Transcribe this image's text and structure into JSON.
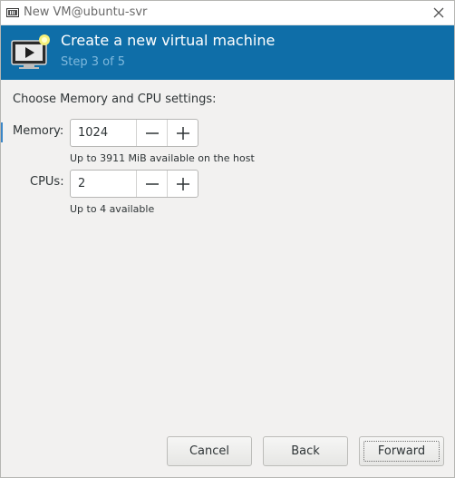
{
  "window": {
    "title": "New VM@ubuntu-svr"
  },
  "header": {
    "title": "Create a new virtual machine",
    "step": "Step 3 of 5"
  },
  "section_label": "Choose Memory and CPU settings:",
  "memory": {
    "label": "Memory:",
    "value": "1024",
    "hint": "Up to 3911 MiB available on the host"
  },
  "cpus": {
    "label": "CPUs:",
    "value": "2",
    "hint": "Up to 4 available"
  },
  "buttons": {
    "cancel": "Cancel",
    "back": "Back",
    "forward": "Forward"
  },
  "colors": {
    "header_bg": "#0f6ea8",
    "step_text": "#7fb9dd",
    "window_bg": "#f2f1f0"
  }
}
